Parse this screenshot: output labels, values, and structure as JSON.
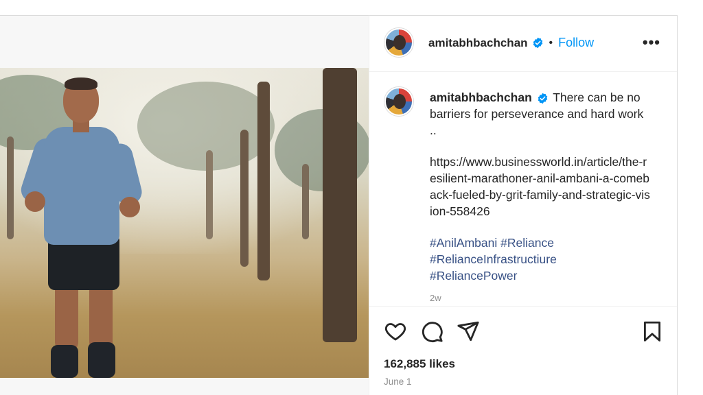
{
  "post": {
    "author": "amitabhbachchan",
    "follow_label": "Follow",
    "separator": "•",
    "more_label": "•••",
    "caption": {
      "text": "There can be no barriers for perseverance and hard work ..",
      "link": "https://www.businessworld.in/article/the-resilient-marathoner-anil-ambani-a-comeback-fueled-by-grit-family-and-strategic-vision-558426",
      "hashtags": [
        "#AnilAmbani",
        "#Reliance",
        "#RelianceInfrastructiure",
        "#ReliancePower"
      ]
    },
    "time_ago": "2w",
    "likes": "162,885 likes",
    "date": "June 1"
  },
  "icons": {
    "like": "heart-icon",
    "comment": "comment-icon",
    "share": "paper-plane-icon",
    "save": "bookmark-icon",
    "verified": "verified-badge-icon"
  },
  "colors": {
    "accent": "#0095f6",
    "hashtag": "#385185",
    "muted": "#8e8e8e",
    "text": "#262626"
  }
}
